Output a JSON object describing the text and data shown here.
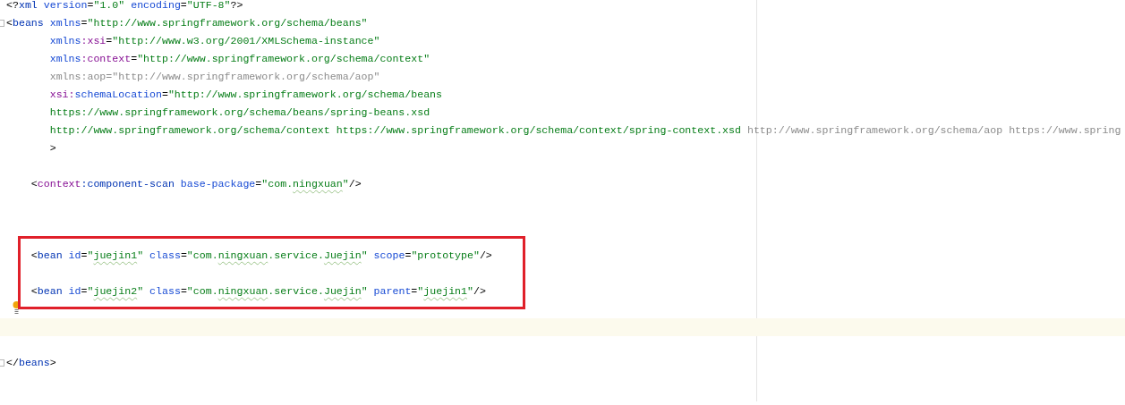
{
  "editor": {
    "lines": [
      {
        "kind": "code",
        "tokens": [
          {
            "kind": "punct",
            "text": "<?"
          },
          {
            "kind": "tag",
            "text": "xml"
          },
          {
            "kind": "attr",
            "text": " version"
          },
          {
            "kind": "punct",
            "text": "="
          },
          {
            "kind": "value",
            "text": "\"1.0\""
          },
          {
            "kind": "attr",
            "text": " encoding"
          },
          {
            "kind": "punct",
            "text": "="
          },
          {
            "kind": "value",
            "text": "\"UTF-8\""
          },
          {
            "kind": "punct",
            "text": "?>"
          }
        ]
      },
      {
        "kind": "code",
        "fold": true,
        "tokens": [
          {
            "kind": "punct",
            "text": "<"
          },
          {
            "kind": "tag",
            "text": "beans"
          },
          {
            "kind": "attr",
            "text": " xmlns"
          },
          {
            "kind": "punct",
            "text": "="
          },
          {
            "kind": "value",
            "text": "\"http://www.springframework.org/schema/beans\""
          }
        ]
      },
      {
        "kind": "code",
        "tokens": [
          {
            "kind": "attr",
            "text": "       xmlns"
          },
          {
            "kind": "ns",
            "text": ":xsi"
          },
          {
            "kind": "punct",
            "text": "="
          },
          {
            "kind": "value",
            "text": "\"http://www.w3.org/2001/XMLSchema-instance\""
          }
        ]
      },
      {
        "kind": "code",
        "tokens": [
          {
            "kind": "attr",
            "text": "       xmlns"
          },
          {
            "kind": "ns",
            "text": ":context"
          },
          {
            "kind": "punct",
            "text": "="
          },
          {
            "kind": "value",
            "text": "\"http://www.springframework.org/schema/context\""
          }
        ]
      },
      {
        "kind": "code",
        "tokens": [
          {
            "kind": "unused",
            "text": "       xmlns:aop=\"http://www.springframework.org/schema/aop\""
          }
        ]
      },
      {
        "kind": "code",
        "tokens": [
          {
            "kind": "ns",
            "text": "       xsi:"
          },
          {
            "kind": "attr",
            "text": "schemaLocation"
          },
          {
            "kind": "punct",
            "text": "="
          },
          {
            "kind": "value",
            "text": "\"http://www.springframework.org/schema/beans"
          }
        ]
      },
      {
        "kind": "code",
        "tokens": [
          {
            "kind": "value",
            "text": "       https://www.springframework.org/schema/beans/spring-beans.xsd"
          }
        ]
      },
      {
        "kind": "code",
        "tokens": [
          {
            "kind": "value",
            "text": "       http://www.springframework.org/schema/context https://www.springframework.org/schema/context/spring-context.xsd"
          },
          {
            "kind": "unused",
            "text": " http://www.springframework.org/schema/aop https://www.spring"
          }
        ]
      },
      {
        "kind": "code",
        "tokens": [
          {
            "kind": "punct",
            "text": "       >"
          }
        ]
      },
      {
        "kind": "blank"
      },
      {
        "kind": "code",
        "tokens": [
          {
            "kind": "punct",
            "text": "    <"
          },
          {
            "kind": "ns",
            "text": "context"
          },
          {
            "kind": "tag",
            "text": ":component-scan"
          },
          {
            "kind": "attr",
            "text": " base-package"
          },
          {
            "kind": "punct",
            "text": "="
          },
          {
            "kind": "value",
            "text": "\"com."
          },
          {
            "kind": "value",
            "text": "ningxuan",
            "typo": true
          },
          {
            "kind": "value",
            "text": "\""
          },
          {
            "kind": "punct",
            "text": "/>"
          }
        ]
      },
      {
        "kind": "blank"
      },
      {
        "kind": "blank"
      },
      {
        "kind": "blank"
      },
      {
        "kind": "code",
        "boxed": true,
        "tokens": [
          {
            "kind": "punct",
            "text": "    <"
          },
          {
            "kind": "tag",
            "text": "bean"
          },
          {
            "kind": "attr",
            "text": " id"
          },
          {
            "kind": "punct",
            "text": "="
          },
          {
            "kind": "value",
            "text": "\""
          },
          {
            "kind": "value",
            "text": "juejin1",
            "typo": true
          },
          {
            "kind": "value",
            "text": "\""
          },
          {
            "kind": "attr",
            "text": " class"
          },
          {
            "kind": "punct",
            "text": "="
          },
          {
            "kind": "value",
            "text": "\"com."
          },
          {
            "kind": "value",
            "text": "ningxuan",
            "typo": true
          },
          {
            "kind": "value",
            "text": ".service."
          },
          {
            "kind": "value",
            "text": "Juejin",
            "typo": true
          },
          {
            "kind": "value",
            "text": "\""
          },
          {
            "kind": "attr",
            "text": " scope"
          },
          {
            "kind": "punct",
            "text": "="
          },
          {
            "kind": "value",
            "text": "\"prototype\""
          },
          {
            "kind": "punct",
            "text": "/>"
          }
        ]
      },
      {
        "kind": "blank",
        "boxed": true
      },
      {
        "kind": "code",
        "boxed": true,
        "tokens": [
          {
            "kind": "punct",
            "text": "    <"
          },
          {
            "kind": "tag",
            "text": "bean"
          },
          {
            "kind": "attr",
            "text": " id"
          },
          {
            "kind": "punct",
            "text": "="
          },
          {
            "kind": "value",
            "text": "\""
          },
          {
            "kind": "value",
            "text": "juejin2",
            "typo": true
          },
          {
            "kind": "value",
            "text": "\""
          },
          {
            "kind": "attr",
            "text": " class"
          },
          {
            "kind": "punct",
            "text": "="
          },
          {
            "kind": "value",
            "text": "\"com."
          },
          {
            "kind": "value",
            "text": "ningxuan",
            "typo": true
          },
          {
            "kind": "value",
            "text": ".service."
          },
          {
            "kind": "value",
            "text": "Juejin",
            "typo": true
          },
          {
            "kind": "value",
            "text": "\""
          },
          {
            "kind": "attr",
            "text": " parent"
          },
          {
            "kind": "punct",
            "text": "="
          },
          {
            "kind": "value",
            "text": "\""
          },
          {
            "kind": "value",
            "text": "juejin1",
            "typo": true
          },
          {
            "kind": "value",
            "text": "\""
          },
          {
            "kind": "punct",
            "text": "/>"
          }
        ]
      },
      {
        "kind": "blank",
        "bulb": true
      },
      {
        "kind": "blank",
        "current": true
      },
      {
        "kind": "blank"
      },
      {
        "kind": "code",
        "fold": true,
        "tokens": [
          {
            "kind": "punct",
            "text": "</"
          },
          {
            "kind": "tag",
            "text": "beans"
          },
          {
            "kind": "punct",
            "text": ">"
          }
        ]
      }
    ]
  }
}
